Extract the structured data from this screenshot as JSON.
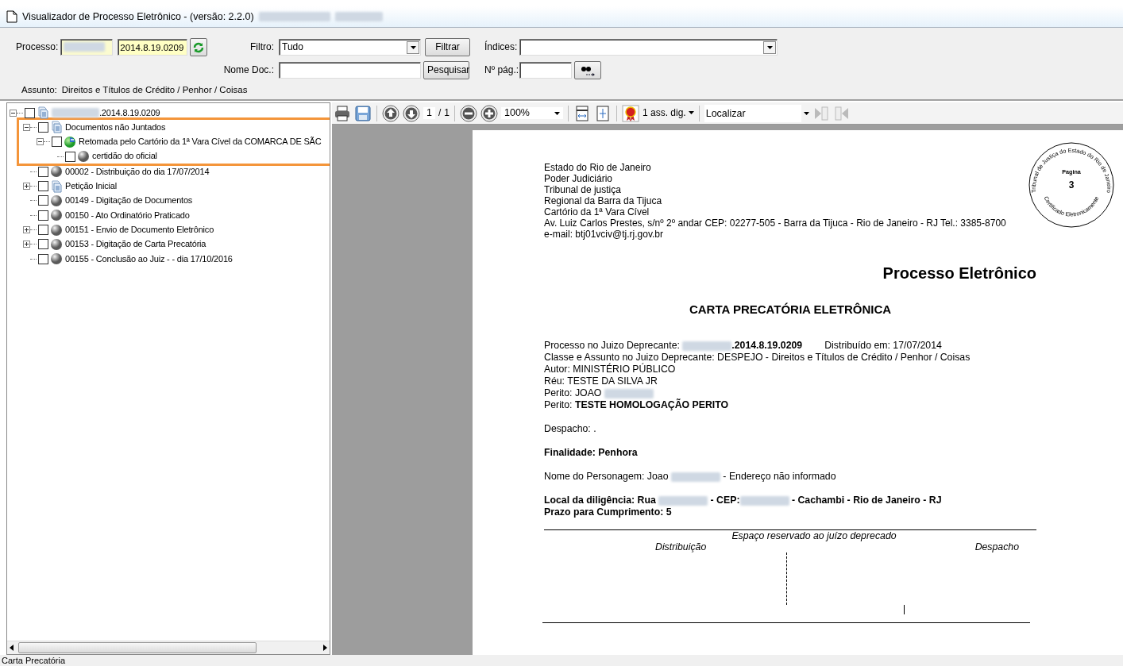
{
  "window": {
    "title": "Visualizador de Processo Eletrônico - (versão: 2.2.0)",
    "redacted_suffix": true
  },
  "search_panel": {
    "processo_label": "Processo:",
    "processo_prefix_redacted": true,
    "processo_number": "2014.8.19.0209",
    "filtro_label": "Filtro:",
    "filtro_value": "Tudo",
    "filtrar_button": "Filtrar",
    "indices_label": "Índices:",
    "nome_doc_label": "Nome Doc.:",
    "pesquisar_button": "Pesquisar",
    "pagina_label": "Nº pág.:",
    "assunto_label": "Assunto:",
    "assunto_value": "Direitos e Títulos de Crédito / Penhor / Coisas"
  },
  "tree": [
    {
      "label": ".2014.8.19.0209",
      "redacted_prefix": true,
      "kind": "documents",
      "checked": false,
      "expanded": true,
      "highlighted": false,
      "children": [
        {
          "label": "Documentos não Juntados",
          "kind": "documents",
          "checked": false,
          "expanded": true,
          "highlighted": true,
          "children": [
            {
              "label": "Retomada pelo Cartório da 1ª Vara Cível da COMARCA DE SÃC",
              "kind": "globe",
              "checked": false,
              "expanded": true,
              "highlighted": false,
              "children": [
                {
                  "label": "certidão do oficial",
                  "kind": "sphere",
                  "checked": false,
                  "highlighted": false
                }
              ]
            }
          ]
        },
        {
          "label": "00002 - Distribuição do dia 17/07/2014",
          "kind": "sphere",
          "checked": false,
          "highlighted": false
        },
        {
          "label": "Petição Inicial",
          "kind": "documents",
          "checked": false,
          "expanded": false,
          "highlighted": false
        },
        {
          "label": "00149 - Digitação de Documentos",
          "kind": "sphere",
          "checked": false,
          "highlighted": false
        },
        {
          "label": "00150 - Ato Ordinatório Praticado",
          "kind": "sphere",
          "checked": false,
          "highlighted": false
        },
        {
          "label": "00151 - Envio de Documento Eletrônico",
          "kind": "sphere",
          "checked": false,
          "expanded": false,
          "highlighted": false
        },
        {
          "label": "00153 - Digitação de Carta Precatória",
          "kind": "sphere",
          "checked": false,
          "expanded": false,
          "highlighted": false
        },
        {
          "label": "00155 - Conclusão ao Juiz -  - dia 17/10/2016",
          "kind": "sphere",
          "checked": false,
          "highlighted": false
        }
      ]
    }
  ],
  "toolbar": {
    "page_current": "1",
    "page_separator": "/",
    "page_total": "1",
    "zoom": "100%",
    "signatures": "1 ass. dig.",
    "search_placeholder": "Localizar",
    "find_buttons": [
      {
        "kind": "previous",
        "disabled": true
      },
      {
        "kind": "next",
        "disabled": true
      }
    ]
  },
  "document": {
    "header_lines": [
      "Estado do Rio de Janeiro",
      "Poder Judiciário",
      "Tribunal de justiça",
      "Regional da Barra da Tijuca",
      "Cartório da 1ª Vara Cível",
      "Av. Luiz Carlos Prestes, s/nº 2º andar CEP: 02277-505 - Barra da Tijuca - Rio de Janeiro - RJ Tel.: 3385-8700",
      "e-mail: btj01vciv@tj.rj.gov.br"
    ],
    "stamp": {
      "top_text": "Tribunal de Justiça do Estado do Rio de Janeiro",
      "label": "Pagina",
      "number": "3",
      "bottom_text": "Certificado Eletronicamente"
    },
    "title": "Processo Eletrônico",
    "heading": "CARTA PRECATÓRIA ELETRÔNICA",
    "paragraphs": [
      {
        "lines": [
          [
            {
              "kind": "text",
              "text": "Processo no Juizo Deprecante: ",
              "bold": false
            },
            {
              "kind": "redacted"
            },
            {
              "kind": "text",
              "text": ".2014.8.19.0209",
              "bold": true
            },
            {
              "kind": "spaced",
              "text": "Distribuído em: 17/07/2014",
              "bold": false
            }
          ],
          [
            {
              "kind": "text",
              "text": "Classe e Assunto no Juizo Deprecante: DESPEJO - Direitos e Títulos de Crédito / Penhor / Coisas",
              "bold": false
            }
          ],
          [
            {
              "kind": "text",
              "text": "Autor: MINISTÉRIO PÚBLICO",
              "bold": false
            }
          ],
          [
            {
              "kind": "text",
              "text": "Réu: TESTE DA SILVA JR",
              "bold": false
            }
          ],
          [
            {
              "kind": "text",
              "text": "Perito: JOAO ",
              "bold": false
            },
            {
              "kind": "redacted"
            }
          ],
          [
            {
              "kind": "text",
              "text": "Perito: ",
              "bold": false
            },
            {
              "kind": "text",
              "text": "TESTE HOMOLOGAÇÃO PERITO",
              "bold": true
            }
          ]
        ]
      },
      {
        "lines": [
          [
            {
              "kind": "text",
              "text": "Despacho: .",
              "bold": false
            }
          ]
        ]
      },
      {
        "lines": [
          [
            {
              "kind": "text",
              "text": "Finalidade: Penhora",
              "bold": true
            }
          ]
        ]
      },
      {
        "lines": [
          [
            {
              "kind": "text",
              "text": "Nome do Personagem: Joao ",
              "bold": false
            },
            {
              "kind": "redacted"
            },
            {
              "kind": "text",
              "text": " - Endereço não informado",
              "bold": false
            }
          ]
        ]
      },
      {
        "lines": [
          [
            {
              "kind": "text",
              "text": "Local da diligência: Rua ",
              "bold": true
            },
            {
              "kind": "redacted"
            },
            {
              "kind": "text",
              "text": " - CEP:",
              "bold": true
            },
            {
              "kind": "redacted"
            },
            {
              "kind": "text",
              "text": " - Cachambi - Rio de Janeiro - RJ",
              "bold": true
            }
          ],
          [
            {
              "kind": "text",
              "text": "Prazo para Cumprimento: 5",
              "bold": true
            }
          ]
        ]
      }
    ],
    "reserved_caption": "Espaço reservado ao juízo deprecado",
    "reserved_left": "Distribuição",
    "reserved_right": "Despacho"
  },
  "status_bar": {
    "text": "Carta Precatória"
  }
}
